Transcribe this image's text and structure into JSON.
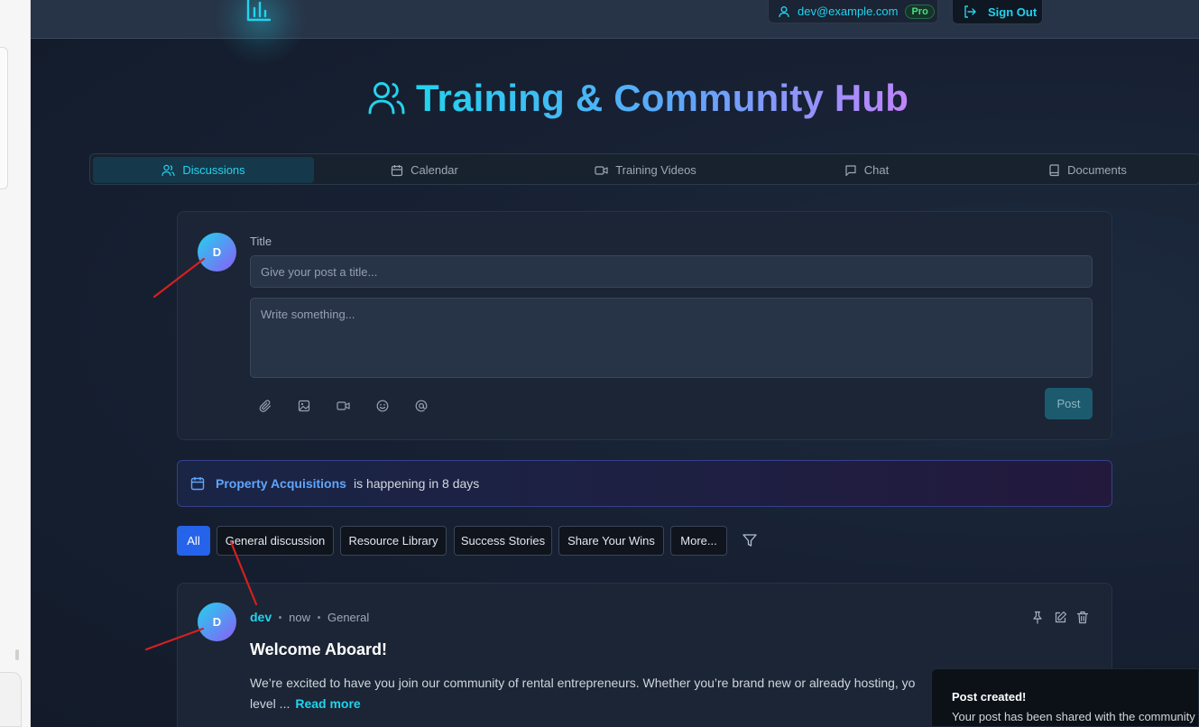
{
  "header": {
    "user_email": "dev@example.com",
    "plan_badge": "Pro",
    "signout_label": "Sign Out"
  },
  "hero": {
    "title": "Training & Community Hub"
  },
  "tabs": [
    {
      "label": "Discussions",
      "icon": "users-icon",
      "active": true
    },
    {
      "label": "Calendar",
      "icon": "calendar-icon"
    },
    {
      "label": "Training Videos",
      "icon": "video-icon"
    },
    {
      "label": "Chat",
      "icon": "chat-icon"
    },
    {
      "label": "Documents",
      "icon": "book-icon"
    }
  ],
  "composer": {
    "avatar_initial": "D",
    "title_label": "Title",
    "title_placeholder": "Give your post a title...",
    "body_placeholder": "Write something...",
    "tools": [
      "paperclip-icon",
      "image-icon",
      "video-icon",
      "smile-icon",
      "at-icon"
    ],
    "post_label": "Post"
  },
  "event": {
    "name": "Property Acquisitions",
    "text": "is happening in 8 days"
  },
  "filters": [
    "All",
    "General discussion",
    "Resource Library",
    "Success Stories",
    "Share Your Wins",
    "More..."
  ],
  "post": {
    "avatar_initial": "D",
    "author": "dev",
    "time": "now",
    "category": "General",
    "title": "Welcome Aboard!",
    "body_line1": "We’re excited to have you join our community of rental entrepreneurs. Whether you’re brand new or already hosting, yo",
    "body_line2": "level ...",
    "read_more": "Read more"
  },
  "toast": {
    "title": "Post created!",
    "description": "Your post has been shared with the community"
  },
  "colors": {
    "accent": "#22d3ee",
    "primary_button": "#2563eb",
    "annotation": "#d42020"
  }
}
